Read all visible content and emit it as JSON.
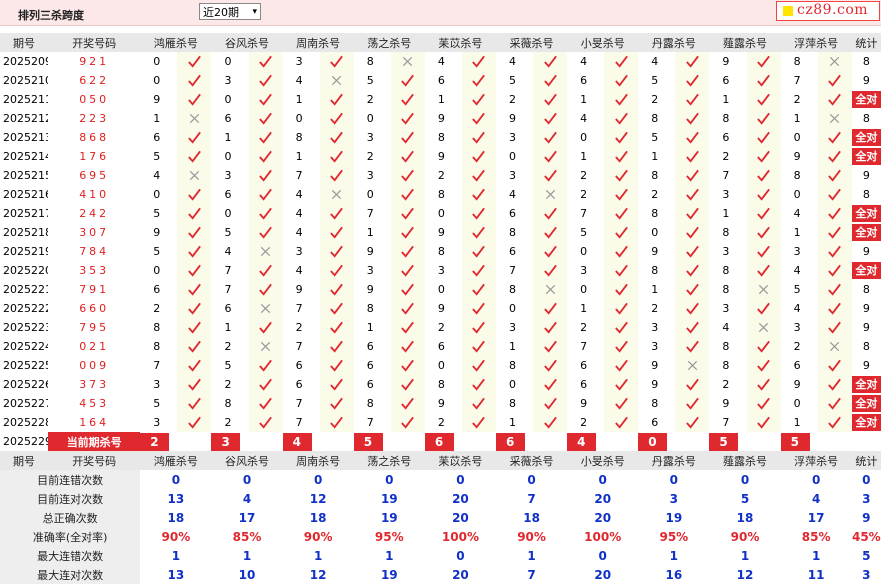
{
  "header": {
    "title": "排列三杀跨度",
    "select_value": "近20期",
    "select_arrow": "▾",
    "logo": "cz89.com"
  },
  "columns": [
    "期号",
    "开奖号码",
    "鸿雁杀号",
    "谷风杀号",
    "周南杀号",
    "荡之杀号",
    "苿苡杀号",
    "采薇杀号",
    "小旻杀号",
    "丹露杀号",
    "薤露杀号",
    "浮萍杀号",
    "统计"
  ],
  "rows": [
    {
      "period": "2025209",
      "draw": "921",
      "picks": [
        "0",
        "0",
        "3",
        "8",
        "4",
        "4",
        "4",
        "4",
        "9",
        "8"
      ],
      "hits": [
        1,
        1,
        1,
        0,
        1,
        1,
        1,
        1,
        1,
        0
      ],
      "total": "8"
    },
    {
      "period": "2025210",
      "draw": "622",
      "picks": [
        "0",
        "3",
        "4",
        "5",
        "6",
        "5",
        "6",
        "5",
        "6",
        "7"
      ],
      "hits": [
        1,
        1,
        0,
        1,
        1,
        1,
        1,
        1,
        1,
        1
      ],
      "total": "9"
    },
    {
      "period": "2025211",
      "draw": "050",
      "picks": [
        "9",
        "0",
        "1",
        "2",
        "1",
        "2",
        "1",
        "2",
        "1",
        "2"
      ],
      "hits": [
        1,
        1,
        1,
        1,
        1,
        1,
        1,
        1,
        1,
        1
      ],
      "total": "全对"
    },
    {
      "period": "2025212",
      "draw": "223",
      "picks": [
        "1",
        "6",
        "0",
        "0",
        "9",
        "9",
        "4",
        "8",
        "8",
        "1"
      ],
      "hits": [
        0,
        1,
        1,
        1,
        1,
        1,
        1,
        1,
        1,
        0
      ],
      "total": "8"
    },
    {
      "period": "2025213",
      "draw": "868",
      "picks": [
        "6",
        "1",
        "8",
        "3",
        "8",
        "3",
        "0",
        "5",
        "6",
        "0"
      ],
      "hits": [
        1,
        1,
        1,
        1,
        1,
        1,
        1,
        1,
        1,
        1
      ],
      "total": "全对"
    },
    {
      "period": "2025214",
      "draw": "176",
      "picks": [
        "5",
        "0",
        "1",
        "2",
        "9",
        "0",
        "1",
        "1",
        "2",
        "9"
      ],
      "hits": [
        1,
        1,
        1,
        1,
        1,
        1,
        1,
        1,
        1,
        1
      ],
      "total": "全对"
    },
    {
      "period": "2025215",
      "draw": "695",
      "picks": [
        "4",
        "3",
        "7",
        "3",
        "2",
        "3",
        "2",
        "8",
        "7",
        "8"
      ],
      "hits": [
        0,
        1,
        1,
        1,
        1,
        1,
        1,
        1,
        1,
        1
      ],
      "total": "9"
    },
    {
      "period": "2025216",
      "draw": "410",
      "picks": [
        "0",
        "6",
        "4",
        "0",
        "8",
        "4",
        "2",
        "2",
        "3",
        "0"
      ],
      "hits": [
        1,
        1,
        0,
        1,
        1,
        0,
        1,
        1,
        1,
        1
      ],
      "total": "8"
    },
    {
      "period": "2025217",
      "draw": "242",
      "picks": [
        "5",
        "0",
        "4",
        "7",
        "0",
        "6",
        "7",
        "8",
        "1",
        "4"
      ],
      "hits": [
        1,
        1,
        1,
        1,
        1,
        1,
        1,
        1,
        1,
        1
      ],
      "total": "全对"
    },
    {
      "period": "2025218",
      "draw": "307",
      "picks": [
        "9",
        "5",
        "4",
        "1",
        "9",
        "8",
        "5",
        "0",
        "8",
        "1"
      ],
      "hits": [
        1,
        1,
        1,
        1,
        1,
        1,
        1,
        1,
        1,
        1
      ],
      "total": "全对"
    },
    {
      "period": "2025219",
      "draw": "784",
      "picks": [
        "5",
        "4",
        "3",
        "9",
        "8",
        "6",
        "0",
        "9",
        "3",
        "3"
      ],
      "hits": [
        1,
        0,
        1,
        1,
        1,
        1,
        1,
        1,
        1,
        1
      ],
      "total": "9"
    },
    {
      "period": "2025220",
      "draw": "353",
      "picks": [
        "0",
        "7",
        "4",
        "3",
        "3",
        "7",
        "3",
        "8",
        "8",
        "4"
      ],
      "hits": [
        1,
        1,
        1,
        1,
        1,
        1,
        1,
        1,
        1,
        1
      ],
      "total": "全对"
    },
    {
      "period": "2025221",
      "draw": "791",
      "picks": [
        "6",
        "7",
        "9",
        "9",
        "0",
        "8",
        "0",
        "1",
        "8",
        "5"
      ],
      "hits": [
        1,
        1,
        1,
        1,
        1,
        0,
        1,
        1,
        0,
        1
      ],
      "total": "8"
    },
    {
      "period": "2025222",
      "draw": "660",
      "picks": [
        "2",
        "6",
        "7",
        "8",
        "9",
        "0",
        "1",
        "2",
        "3",
        "4"
      ],
      "hits": [
        1,
        0,
        1,
        1,
        1,
        1,
        1,
        1,
        1,
        1
      ],
      "total": "9"
    },
    {
      "period": "2025223",
      "draw": "795",
      "picks": [
        "8",
        "1",
        "2",
        "1",
        "2",
        "3",
        "2",
        "3",
        "4",
        "3"
      ],
      "hits": [
        1,
        1,
        1,
        1,
        1,
        1,
        1,
        1,
        0,
        1
      ],
      "total": "9"
    },
    {
      "period": "2025224",
      "draw": "021",
      "picks": [
        "8",
        "2",
        "7",
        "6",
        "6",
        "1",
        "7",
        "3",
        "8",
        "2"
      ],
      "hits": [
        1,
        0,
        1,
        1,
        1,
        1,
        1,
        1,
        1,
        0
      ],
      "total": "8"
    },
    {
      "period": "2025225",
      "draw": "009",
      "picks": [
        "7",
        "5",
        "6",
        "6",
        "0",
        "8",
        "6",
        "9",
        "8",
        "6"
      ],
      "hits": [
        1,
        1,
        1,
        1,
        1,
        1,
        1,
        0,
        1,
        1
      ],
      "total": "9"
    },
    {
      "period": "2025226",
      "draw": "373",
      "picks": [
        "3",
        "2",
        "6",
        "6",
        "8",
        "0",
        "6",
        "9",
        "2",
        "9"
      ],
      "hits": [
        1,
        1,
        1,
        1,
        1,
        1,
        1,
        1,
        1,
        1
      ],
      "total": "全对"
    },
    {
      "period": "2025227",
      "draw": "453",
      "picks": [
        "5",
        "8",
        "7",
        "8",
        "9",
        "8",
        "9",
        "8",
        "9",
        "0"
      ],
      "hits": [
        1,
        1,
        1,
        1,
        1,
        1,
        1,
        1,
        1,
        1
      ],
      "total": "全对"
    },
    {
      "period": "2025228",
      "draw": "164",
      "picks": [
        "3",
        "2",
        "7",
        "7",
        "2",
        "1",
        "2",
        "6",
        "7",
        "1"
      ],
      "hits": [
        1,
        1,
        1,
        1,
        1,
        1,
        1,
        1,
        1,
        1
      ],
      "total": "全对"
    }
  ],
  "current": {
    "period": "2025229",
    "label": "当前期杀号",
    "picks": [
      "2",
      "3",
      "4",
      "5",
      "6",
      "6",
      "4",
      "0",
      "5",
      "5"
    ]
  },
  "stats": [
    {
      "label": "目前连错次数",
      "values": [
        "0",
        "0",
        "0",
        "0",
        "0",
        "0",
        "0",
        "0",
        "0",
        "0",
        "0"
      ],
      "red": false
    },
    {
      "label": "目前连对次数",
      "values": [
        "13",
        "4",
        "12",
        "19",
        "20",
        "7",
        "20",
        "3",
        "5",
        "4",
        "3"
      ],
      "red": false
    },
    {
      "label": "总正确次数",
      "values": [
        "18",
        "17",
        "18",
        "19",
        "20",
        "18",
        "20",
        "19",
        "18",
        "17",
        "9"
      ],
      "red": false
    },
    {
      "label": "准确率(全对率)",
      "values": [
        "90%",
        "85%",
        "90%",
        "95%",
        "100%",
        "90%",
        "100%",
        "95%",
        "90%",
        "85%",
        "45%"
      ],
      "red": true
    },
    {
      "label": "最大连错次数",
      "values": [
        "1",
        "1",
        "1",
        "1",
        "0",
        "1",
        "0",
        "1",
        "1",
        "1",
        "5"
      ],
      "red": false
    },
    {
      "label": "最大连对次数",
      "values": [
        "13",
        "10",
        "12",
        "19",
        "20",
        "7",
        "20",
        "16",
        "12",
        "11",
        "3"
      ],
      "red": false
    }
  ],
  "colors": {
    "red": "#e02020",
    "blue": "#1030c8",
    "header_bg": "#e8e8e8",
    "mark_bg": "#fbfbea"
  }
}
